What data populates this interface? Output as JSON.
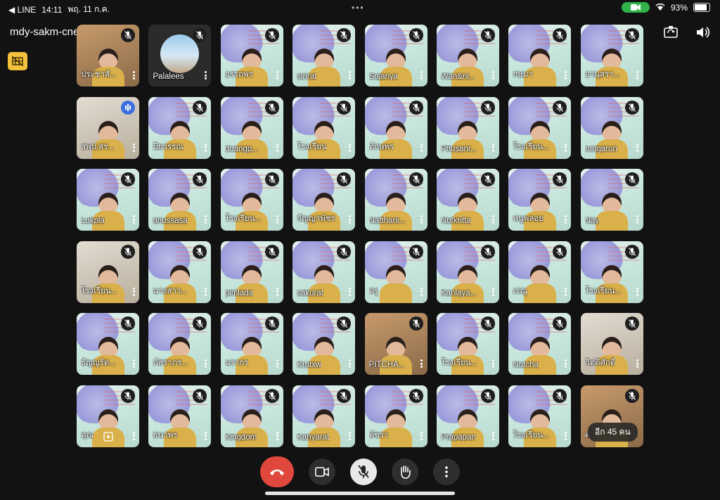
{
  "status_bar": {
    "back_app": "◀ LINE",
    "time": "14:11",
    "date": "พฤ. 11 ก.ค.",
    "battery": "93%"
  },
  "meeting": {
    "title": "mdy-sakm-cne"
  },
  "participants": [
    {
      "name": "ประชาสั...",
      "mic": "muted",
      "kind": "warm"
    },
    {
      "name": "Palalees",
      "mic": "muted",
      "kind": "avatar"
    },
    {
      "name": "อรรถพร",
      "mic": "muted",
      "kind": "video"
    },
    {
      "name": "sirirat",
      "mic": "muted",
      "kind": "video"
    },
    {
      "name": "Sujanya",
      "mic": "muted",
      "kind": "video"
    },
    {
      "name": "Wan&ni...",
      "mic": "muted",
      "kind": "video"
    },
    {
      "name": "กษมา",
      "mic": "muted",
      "kind": "video"
    },
    {
      "name": "อานุสรา...",
      "mic": "muted",
      "kind": "video"
    },
    {
      "name": "สพป.สร...",
      "mic": "speaking",
      "kind": "office"
    },
    {
      "name": "ปิยวรรณ",
      "mic": "muted",
      "kind": "video"
    },
    {
      "name": "duangp...",
      "mic": "muted",
      "kind": "video"
    },
    {
      "name": "โรงเรียน",
      "mic": "muted",
      "kind": "video"
    },
    {
      "name": "ทักษพร",
      "mic": "muted",
      "kind": "video"
    },
    {
      "name": "Phusani...",
      "mic": "muted",
      "kind": "video"
    },
    {
      "name": "โรงเรียน...",
      "mic": "muted",
      "kind": "video"
    },
    {
      "name": "rungarun",
      "mic": "muted",
      "kind": "video"
    },
    {
      "name": "Lukpla",
      "mic": "muted",
      "kind": "video"
    },
    {
      "name": "anussasa",
      "mic": "muted",
      "kind": "video"
    },
    {
      "name": "โรงเรียน...",
      "mic": "muted",
      "kind": "video"
    },
    {
      "name": "กัญญาพัชร",
      "mic": "muted",
      "kind": "video"
    },
    {
      "name": "Nattharii...",
      "mic": "muted",
      "kind": "video"
    },
    {
      "name": "Nutkritta",
      "mic": "muted",
      "kind": "video"
    },
    {
      "name": "หนูพลอย",
      "mic": "muted",
      "kind": "video"
    },
    {
      "name": "Nay",
      "mic": "muted",
      "kind": "video"
    },
    {
      "name": "โรงเรียน...",
      "mic": "muted",
      "kind": "office"
    },
    {
      "name": "นางสาว...",
      "mic": "muted",
      "kind": "video"
    },
    {
      "name": "pimlada",
      "mic": "muted",
      "kind": "video"
    },
    {
      "name": "sakurat",
      "mic": "muted",
      "kind": "video"
    },
    {
      "name": "ครู",
      "mic": "muted",
      "kind": "video"
    },
    {
      "name": "Kanlaya...",
      "mic": "muted",
      "kind": "video"
    },
    {
      "name": "เรณู",
      "mic": "muted",
      "kind": "video"
    },
    {
      "name": "โรงเรียน...",
      "mic": "muted",
      "kind": "video"
    },
    {
      "name": "ธัญญรัต...",
      "mic": "muted",
      "kind": "video"
    },
    {
      "name": "ภัสราภร...",
      "mic": "muted",
      "kind": "video"
    },
    {
      "name": "นรากร",
      "mic": "muted",
      "kind": "video"
    },
    {
      "name": "Krubiw",
      "mic": "muted",
      "kind": "video"
    },
    {
      "name": "PITCHA...",
      "mic": "muted",
      "kind": "warm"
    },
    {
      "name": "โรงเรียน...",
      "mic": "muted",
      "kind": "video"
    },
    {
      "name": "Nutcha",
      "mic": "muted",
      "kind": "video"
    },
    {
      "name": "กิตติศักดิ์",
      "mic": "muted",
      "kind": "office"
    },
    {
      "name": "คุณ",
      "mic": "muted",
      "kind": "video",
      "self": true
    },
    {
      "name": "ธนาพร",
      "mic": "muted",
      "kind": "video"
    },
    {
      "name": "Kingdom",
      "mic": "muted",
      "kind": "video"
    },
    {
      "name": "Kanyarat",
      "mic": "muted",
      "kind": "video"
    },
    {
      "name": "พัชรา",
      "mic": "muted",
      "kind": "video"
    },
    {
      "name": "Prapapan",
      "mic": "muted",
      "kind": "video"
    },
    {
      "name": "โรงเรียน...",
      "mic": "muted",
      "kind": "video"
    },
    {
      "name": "ค",
      "mic": "muted",
      "kind": "warm",
      "more": "อีก 45 คน"
    }
  ],
  "controls": [
    "end-call",
    "camera",
    "microphone-muted",
    "raise-hand",
    "more-options"
  ],
  "icons": {
    "muted": "mic-off-icon",
    "speaking": "audio-level-icon",
    "flip": "camera-flip-icon",
    "volume": "speaker-icon"
  }
}
